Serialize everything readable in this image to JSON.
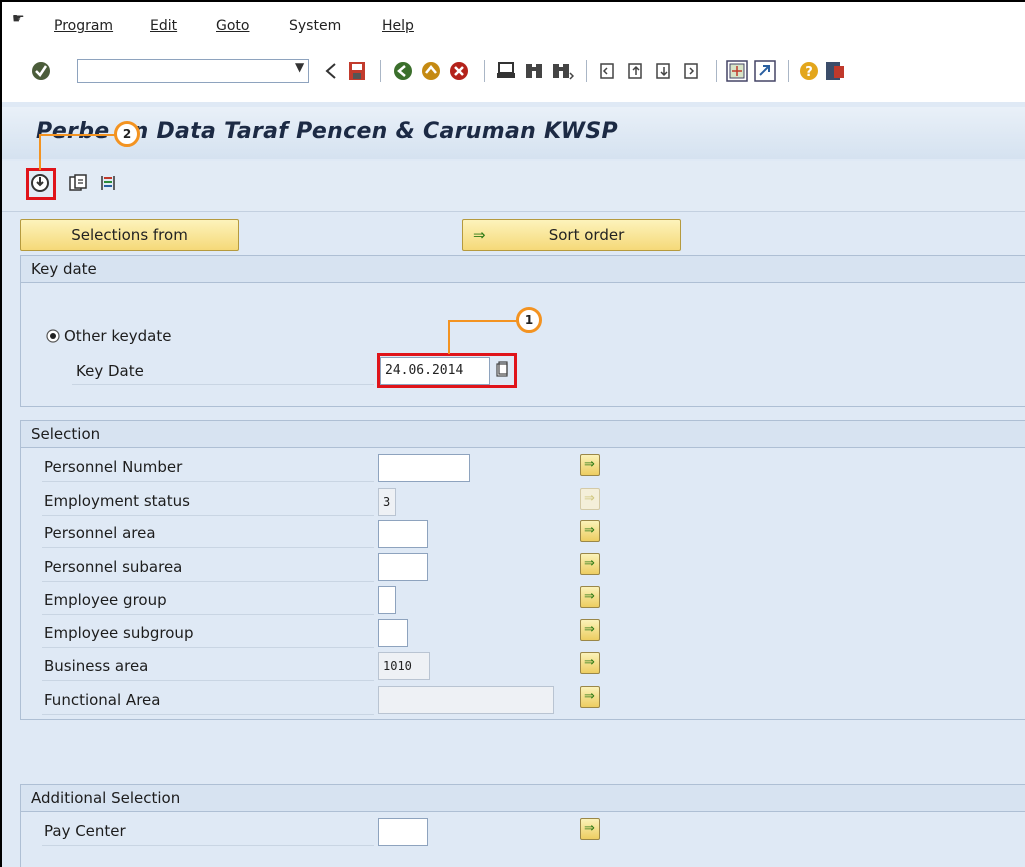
{
  "menu": {
    "items": [
      "Program",
      "Edit",
      "Goto",
      "System",
      "Help"
    ]
  },
  "toolbar": {
    "command_value": "",
    "icons": [
      "enter-icon",
      "back-icon",
      "save-icon",
      "back-circle-icon",
      "exit-icon",
      "cancel-icon",
      "print-icon",
      "find-icon",
      "find-next-icon",
      "first-page-icon",
      "prev-page-icon",
      "next-page-icon",
      "last-page-icon",
      "new-session-icon",
      "shortcut-icon",
      "help-icon",
      "layout-icon"
    ]
  },
  "title": "Perbe  an Data Taraf Pencen & Caruman KWSP",
  "buttons": {
    "selections_from": "Selections from",
    "sort_order": "Sort order"
  },
  "keydate_group": {
    "header": "Key date",
    "radio_label": "Other keydate",
    "key_date_label": "Key Date",
    "key_date_value": "24.06.2014"
  },
  "selection_group": {
    "header": "Selection",
    "rows": [
      {
        "label": "Personnel Number",
        "value": ""
      },
      {
        "label": "Employment status",
        "value": "3"
      },
      {
        "label": "Personnel area",
        "value": ""
      },
      {
        "label": "Personnel subarea",
        "value": ""
      },
      {
        "label": "Employee group",
        "value": ""
      },
      {
        "label": "Employee subgroup",
        "value": ""
      },
      {
        "label": "Business area",
        "value": "1010"
      },
      {
        "label": "Functional Area",
        "value": ""
      }
    ]
  },
  "additional_group": {
    "header": "Additional Selection",
    "rows": [
      {
        "label": "Pay Center",
        "value": ""
      }
    ]
  },
  "callouts": {
    "one": "1",
    "two": "2"
  },
  "colors": {
    "highlight_red": "#e0141a",
    "callout_orange": "#f39321",
    "background": "#dfe9f5",
    "button_yellow": "#f5d979"
  }
}
